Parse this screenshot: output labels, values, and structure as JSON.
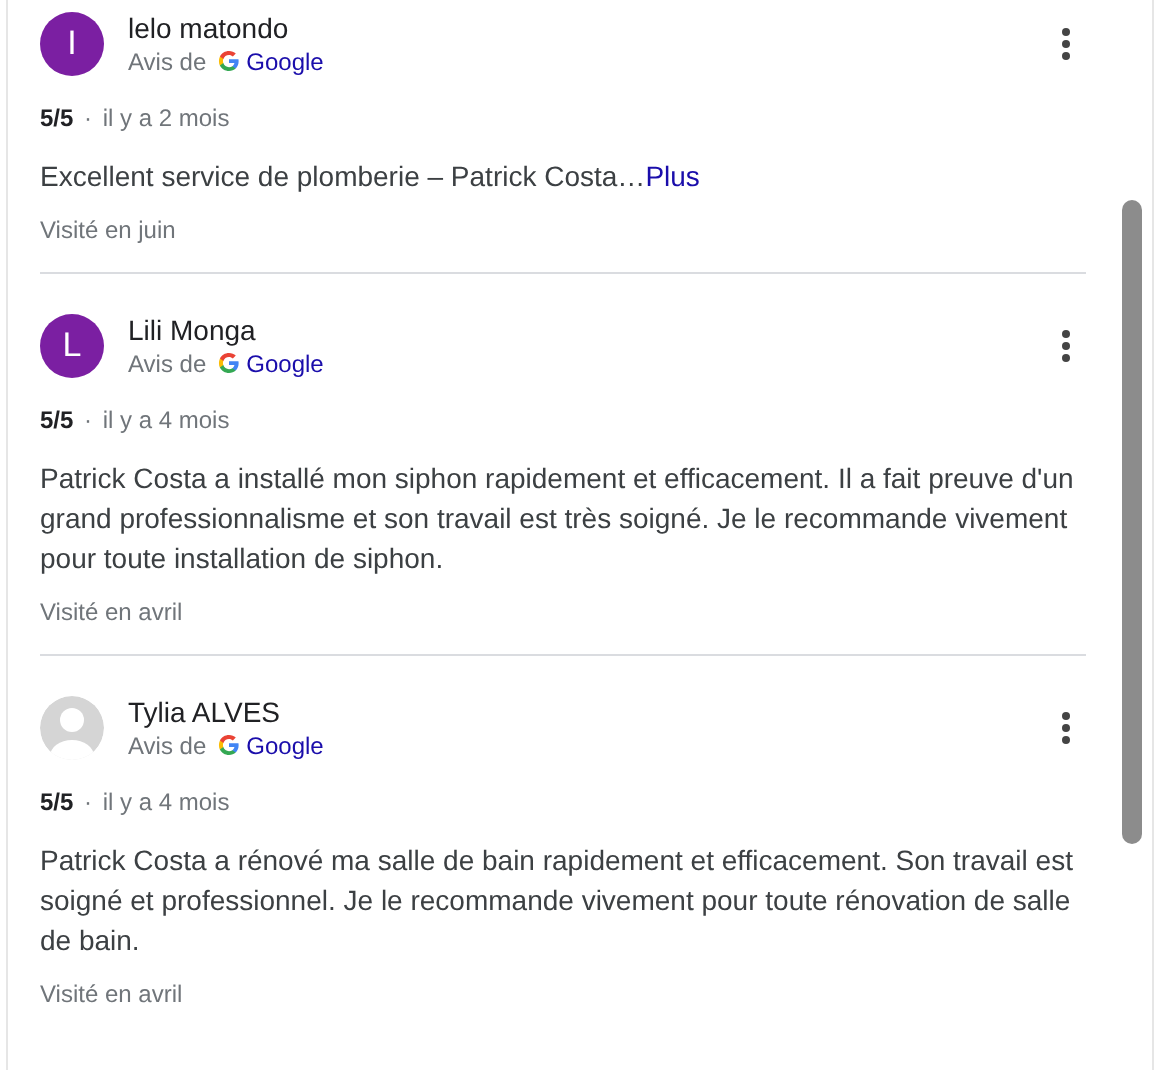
{
  "reviews": [
    {
      "author": "lelo matondo",
      "avatar": {
        "kind": "letter",
        "letter": "I",
        "color": "#7b1fa2"
      },
      "source_prefix": "Avis de",
      "source": "Google",
      "rating": "5/5",
      "separator": "·",
      "time": "il y a 2 mois",
      "text": "Excellent service de plomberie – Patrick Costa…",
      "more_link": "Plus",
      "visited": "Visité en juin"
    },
    {
      "author": "Lili Monga",
      "avatar": {
        "kind": "letter",
        "letter": "L",
        "color": "#7b1fa2"
      },
      "source_prefix": "Avis de",
      "source": "Google",
      "rating": "5/5",
      "separator": "·",
      "time": "il y a 4 mois",
      "text": "Patrick Costa a installé mon siphon rapidement et efficacement. Il a fait preuve d'un grand professionnalisme et son travail est très soigné. Je le recommande vivement pour toute installation de siphon.",
      "visited": "Visité en avril"
    },
    {
      "author": "Tylia ALVES",
      "avatar": {
        "kind": "silhouette"
      },
      "source_prefix": "Avis de",
      "source": "Google",
      "rating": "5/5",
      "separator": "·",
      "time": "il y a 4 mois",
      "text": "Patrick Costa a rénové ma salle de bain rapidement et efficacement. Son travail est soigné et professionnel. Je le recommande vivement pour toute rénovation de salle de bain.",
      "visited": "Visité en avril"
    }
  ]
}
